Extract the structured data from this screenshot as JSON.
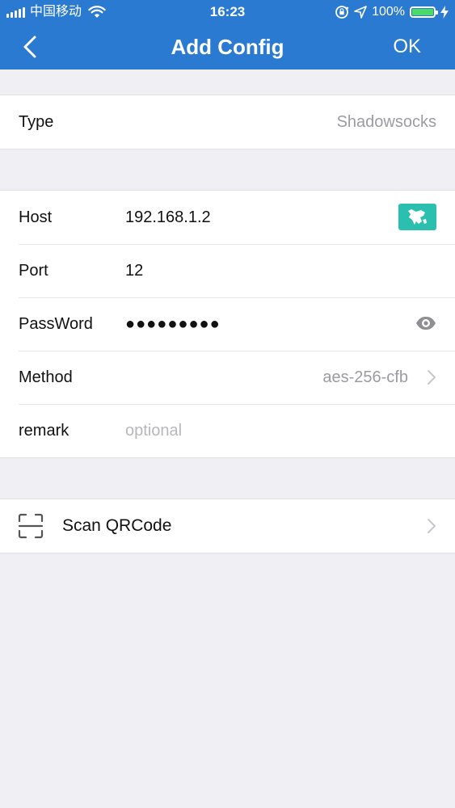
{
  "status_bar": {
    "carrier": "中国移动",
    "time": "16:23",
    "battery_percent": "100%",
    "battery_level": 1.0,
    "icons": [
      "signal-icon",
      "wifi-icon",
      "orientation-lock-icon",
      "location-arrow-icon",
      "battery-icon",
      "charging-bolt-icon"
    ]
  },
  "nav": {
    "title": "Add Config",
    "ok_label": "OK",
    "back_icon": "chevron-left-icon"
  },
  "type_row": {
    "label": "Type",
    "value": "Shadowsocks"
  },
  "form": {
    "host": {
      "label": "Host",
      "value": "192.168.1.2",
      "flag_icon": "country-flag-icon"
    },
    "port": {
      "label": "Port",
      "value": "12"
    },
    "password": {
      "label": "PassWord",
      "masked": "●●●●●●●●●",
      "toggle_icon": "eye-icon"
    },
    "method": {
      "label": "Method",
      "value": "aes-256-cfb"
    },
    "remark": {
      "label": "remark",
      "placeholder": "optional"
    }
  },
  "scan": {
    "label": "Scan QRCode",
    "icon": "qr-scan-icon"
  },
  "colors": {
    "header_bg": "#2a7ad2",
    "page_bg": "#efeff4",
    "flag_bg": "#2bbfb0",
    "muted_text": "#9b9ba1",
    "placeholder_text": "#b7b7bd",
    "battery_fill": "#4cd964"
  }
}
